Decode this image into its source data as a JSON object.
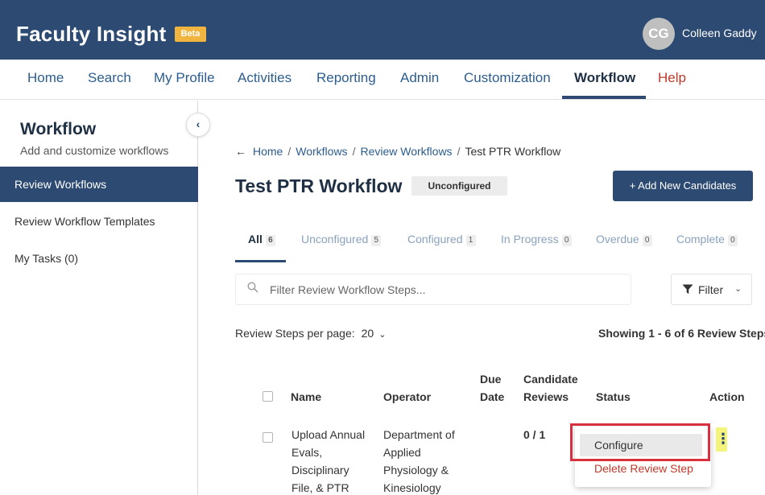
{
  "header": {
    "app_title": "Faculty Insight",
    "beta_label": "Beta",
    "avatar_initials": "CG",
    "user_name": "Colleen Gaddy",
    "user_caret": "⌄"
  },
  "nav": {
    "items": [
      "Home",
      "Search",
      "My Profile",
      "Activities",
      "Reporting",
      "Admin",
      "Customization",
      "Workflow",
      "Help"
    ],
    "active": "Workflow"
  },
  "sidebar": {
    "title": "Workflow",
    "subtitle": "Add and customize workflows",
    "collapse_glyph": "‹",
    "items": [
      "Review Workflows",
      "Review Workflow Templates",
      "My Tasks (0)"
    ],
    "active": "Review Workflows"
  },
  "breadcrumb": {
    "back_glyph": "←",
    "items": [
      "Home",
      "Workflows",
      "Review Workflows",
      "Test PTR Workflow"
    ],
    "separator": "/"
  },
  "page": {
    "title": "Test PTR Workflow",
    "status": "Unconfigured",
    "add_button": "+ Add New Candidates"
  },
  "tabs": [
    {
      "label": "All",
      "count": "6"
    },
    {
      "label": "Unconfigured",
      "count": "5"
    },
    {
      "label": "Configured",
      "count": "1"
    },
    {
      "label": "In Progress",
      "count": "0"
    },
    {
      "label": "Overdue",
      "count": "0"
    },
    {
      "label": "Complete",
      "count": "0"
    }
  ],
  "filter": {
    "placeholder": "Filter Review Workflow Steps...",
    "button_label": "Filter",
    "chevron": "⌄"
  },
  "pagination": {
    "per_page_label": "Review Steps per page:",
    "per_page_value": "20",
    "chevron": "⌄",
    "showing": "Showing 1 - 6 of 6 Review Steps"
  },
  "table": {
    "headers": {
      "name": "Name",
      "operator": "Operator",
      "due_date_1": "Due",
      "due_date_2": "Date",
      "candidate_1": "Candidate",
      "candidate_2": "Reviews",
      "status": "Status",
      "action": "Action"
    },
    "rows": [
      {
        "name_lines": [
          "Upload Annual",
          "Evals,",
          "Disciplinary",
          "File, & PTR"
        ],
        "operator_lines": [
          "Department of",
          "Applied",
          "Physiology &",
          "Kinesiology"
        ],
        "candidate_reviews": "0 / 1"
      }
    ]
  },
  "action_menu": {
    "kebab_glyph": "⋮",
    "configure": "Configure",
    "delete": "Delete Review Step"
  },
  "colors": {
    "brand_navy": "#2c4a72",
    "link_blue": "#2c5d8f",
    "beta_yellow": "#f1b43e",
    "danger_red": "#c0392b",
    "highlight_red": "#d9303f"
  }
}
